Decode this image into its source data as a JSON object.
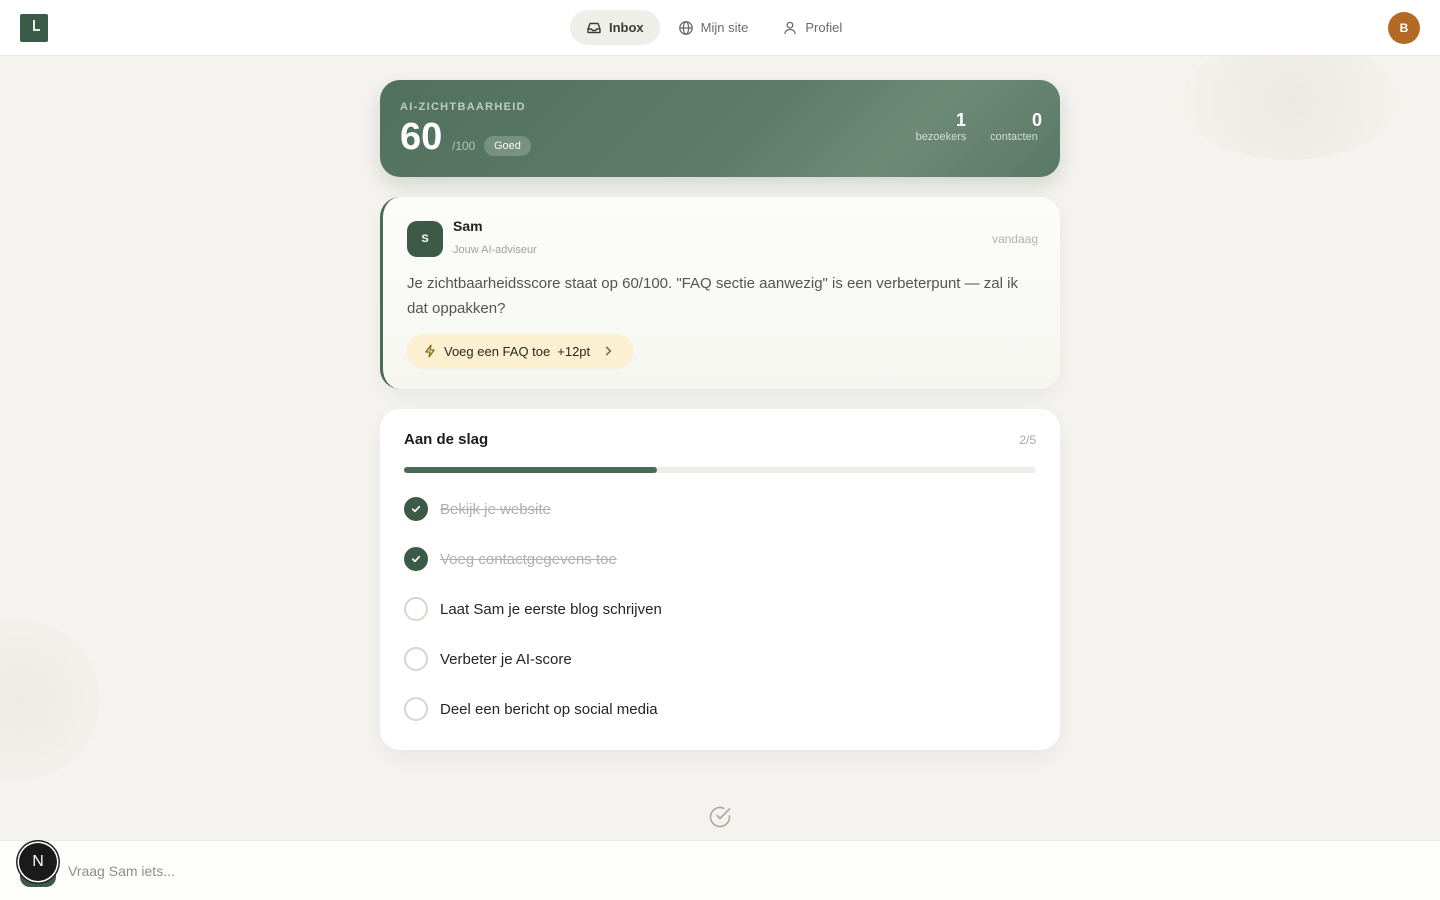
{
  "nav": {
    "items": [
      {
        "label": "Inbox",
        "icon": "inbox-icon",
        "active": true
      },
      {
        "label": "Mijn site",
        "icon": "globe-icon",
        "active": false
      },
      {
        "label": "Profiel",
        "icon": "user-icon",
        "active": false
      }
    ],
    "avatar_initial": "B"
  },
  "score": {
    "label": "AI-ZICHTBAARHEID",
    "value": "60",
    "max": "/100",
    "badge": "Goed",
    "stats": [
      {
        "value": "1",
        "label": "bezoekers"
      },
      {
        "value": "0",
        "label": "contacten"
      }
    ]
  },
  "sam": {
    "avatar_initial": "S",
    "name": "Sam",
    "role": "Jouw AI-adviseur",
    "time": "vandaag",
    "message": "Je zichtbaarheidsscore staat op 60/100. \"FAQ sectie aanwezig\" is een verbeterpunt — zal ik dat oppakken?",
    "action": {
      "label": "Voeg een FAQ toe",
      "points": "+12pt",
      "icon": "lightning-icon"
    }
  },
  "checklist": {
    "title": "Aan de slag",
    "count": "2/5",
    "progress": 0.4,
    "tasks": [
      {
        "label": "Bekijk je website",
        "done": true
      },
      {
        "label": "Voeg contactgegevens toe",
        "done": true
      },
      {
        "label": "Laat Sam je eerste blog schrijven",
        "done": false
      },
      {
        "label": "Verbeter je AI-score",
        "done": false
      },
      {
        "label": "Deel een bericht op social media",
        "done": false
      }
    ]
  },
  "input": {
    "placeholder": "Vraag Sam iets...",
    "value": "",
    "badge": "N"
  },
  "colors": {
    "accent": "#3d5a49",
    "avatar": "#b26a24",
    "chip": "#fbf0cf"
  }
}
